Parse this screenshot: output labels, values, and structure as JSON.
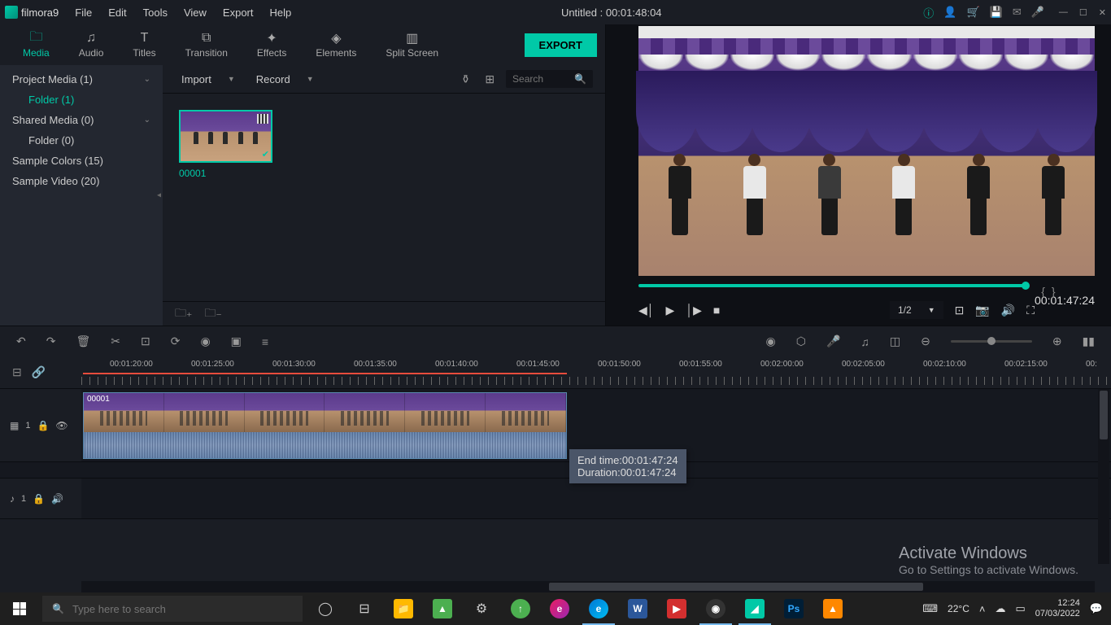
{
  "app": {
    "name": "filmora9",
    "title": "Untitled : 00:01:48:04"
  },
  "menu": [
    "File",
    "Edit",
    "Tools",
    "View",
    "Export",
    "Help"
  ],
  "tabs": [
    {
      "label": "Media",
      "active": true
    },
    {
      "label": "Audio"
    },
    {
      "label": "Titles"
    },
    {
      "label": "Transition"
    },
    {
      "label": "Effects"
    },
    {
      "label": "Elements"
    },
    {
      "label": "Split Screen"
    }
  ],
  "export_label": "EXPORT",
  "sidebar": {
    "items": [
      {
        "label": "Project Media (1)",
        "chev": true
      },
      {
        "label": "Folder (1)",
        "sub": true,
        "active": true
      },
      {
        "label": "Shared Media (0)",
        "chev": true
      },
      {
        "label": "Folder (0)",
        "sub": true
      },
      {
        "label": "Sample Colors (15)"
      },
      {
        "label": "Sample Video (20)"
      }
    ]
  },
  "browser": {
    "import": "Import",
    "record": "Record",
    "search_placeholder": "Search",
    "clip_name": "00001"
  },
  "preview": {
    "time": "00:01:47:24",
    "zoom": "1/2"
  },
  "timeline": {
    "marks": [
      "00:01:20:00",
      "00:01:25:00",
      "00:01:30:00",
      "00:01:35:00",
      "00:01:40:00",
      "00:01:45:00",
      "00:01:50:00",
      "00:01:55:00",
      "00:02:00:00",
      "00:02:05:00",
      "00:02:10:00",
      "00:02:15:00",
      "00:"
    ],
    "video_track": "1",
    "audio_track": "1",
    "clip_label": "00001"
  },
  "tooltip": {
    "end_label": "End time:",
    "end_value": "00:01:47:24",
    "dur_label": "Duration:",
    "dur_value": "00:01:47:24"
  },
  "watermark": {
    "title": "Activate Windows",
    "sub": "Go to Settings to activate Windows."
  },
  "taskbar": {
    "search_placeholder": "Type here to search",
    "weather": "22°C",
    "time": "12:24",
    "date": "07/03/2022"
  }
}
